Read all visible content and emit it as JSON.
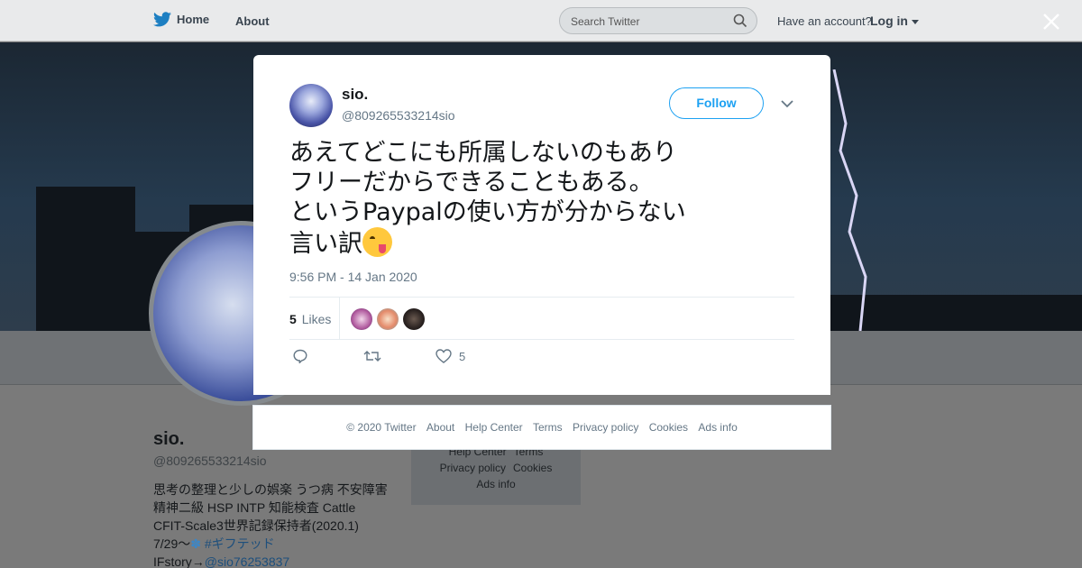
{
  "topbar": {
    "home_label": "Home",
    "about_label": "About",
    "search_placeholder": "Search Twitter",
    "have_account": "Have an account?",
    "login_label": "Log in"
  },
  "profile": {
    "name": "sio.",
    "handle": "@809265533214sio",
    "bio_line1": "思考の整理と少しの娯楽 うつ病 不安障害",
    "bio_line2": "精神二級 HSP INTP 知能検査 Cattle",
    "bio_line3": "CFIT-Scale3世界記録保持者(2020.1)",
    "bio_line4_prefix": "7/29〜",
    "bio_line4_tag": "#ギフテッド",
    "bio_line5_prefix": "IFstory→",
    "bio_line5_link": "@sio76253837"
  },
  "background_footer": {
    "links": [
      "Help Center",
      "Terms",
      "Privacy policy",
      "Cookies",
      "Ads info"
    ]
  },
  "tweet": {
    "author_name": "sio.",
    "author_handle": "@809265533214sio",
    "follow_label": "Follow",
    "text": "あえてどこにも所属しないのもあり\nフリーだからできることもある。\nというPaypalの使い方が分からない\n言い訳",
    "timestamp": "9:56 PM - 14 Jan 2020",
    "likes_count": "5",
    "likes_label": "Likes",
    "action_like_count": "5"
  },
  "modal_footer": {
    "copyright": "© 2020 Twitter",
    "links": [
      "About",
      "Help Center",
      "Terms",
      "Privacy policy",
      "Cookies",
      "Ads info"
    ]
  },
  "colors": {
    "twitter_blue": "#1da1f2",
    "secondary_text": "#657786"
  }
}
